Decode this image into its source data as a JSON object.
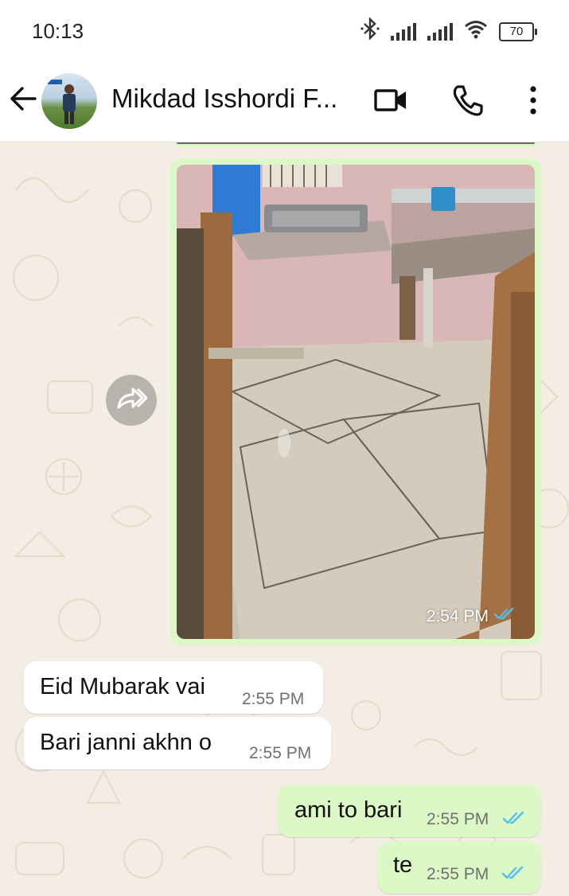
{
  "status_bar": {
    "time": "10:13",
    "battery": "70"
  },
  "header": {
    "contact_name": "Mikdad Isshordi F..."
  },
  "messages": [
    {
      "direction": "out",
      "type": "image",
      "time": "2:54 PM",
      "status": "read"
    },
    {
      "direction": "in",
      "text": "Eid Mubarak vai",
      "time": "2:55 PM"
    },
    {
      "direction": "in",
      "text": "Bari janni akhn o",
      "time": "2:55 PM"
    },
    {
      "direction": "out",
      "text": "ami to bari",
      "time": "2:55 PM",
      "status": "read"
    },
    {
      "direction": "out",
      "text": "te",
      "time": "2:55 PM",
      "status": "read"
    }
  ],
  "icons": [
    "bluetooth-icon",
    "signal-icon",
    "wifi-icon",
    "battery-icon",
    "back-arrow-icon",
    "video-call-icon",
    "voice-call-icon",
    "more-options-icon",
    "forward-icon",
    "double-check-icon"
  ],
  "colors": {
    "outgoing_bubble": "#dcf8c6",
    "incoming_bubble": "#ffffff",
    "chat_background": "#f3ede4",
    "read_ticks": "#53bdeb"
  }
}
